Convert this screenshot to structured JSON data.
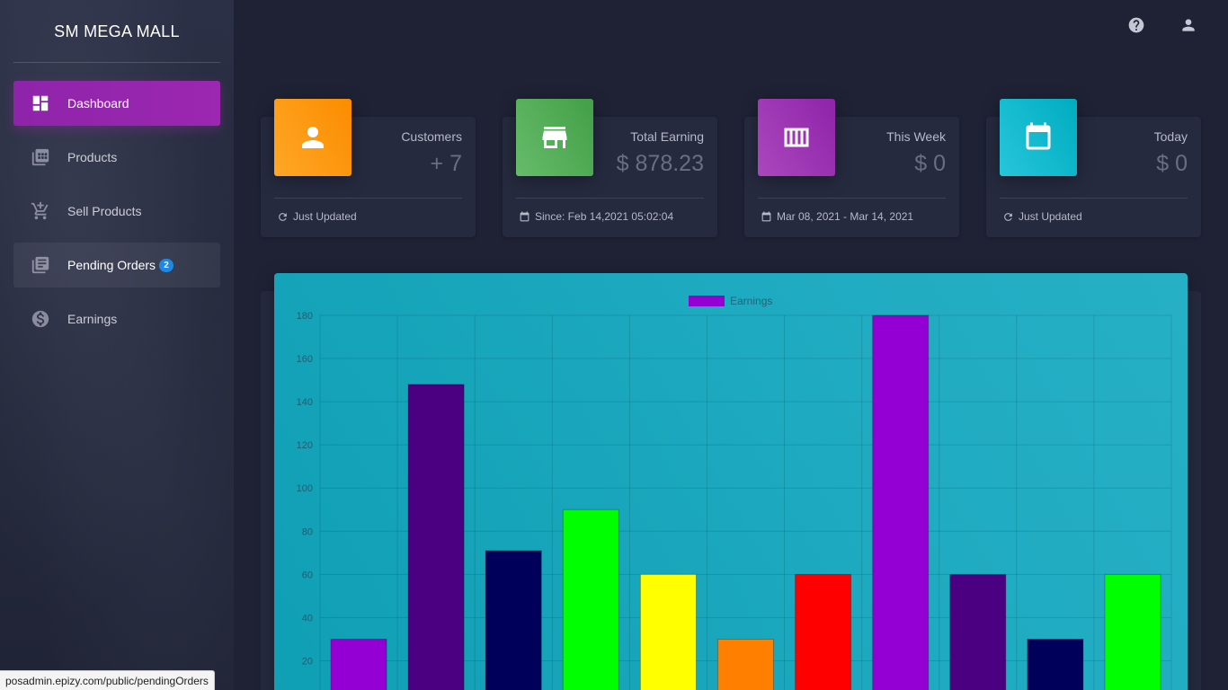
{
  "brand": "SM MEGA MALL",
  "sidebar": {
    "items": [
      {
        "label": "Dashboard",
        "icon": "dashboard-icon",
        "active": true
      },
      {
        "label": "Products",
        "icon": "products-icon"
      },
      {
        "label": "Sell Products",
        "icon": "cart-add-icon"
      },
      {
        "label": "Pending Orders",
        "icon": "orders-icon",
        "badge": "2"
      },
      {
        "label": "Earnings",
        "icon": "dollar-icon"
      }
    ]
  },
  "topbar": {
    "help_icon": "help-icon",
    "user_icon": "user-icon"
  },
  "cards": [
    {
      "title": "Customers",
      "value": "+ 7",
      "footer": "Just Updated",
      "icon": "person-icon",
      "footer_icon": "refresh-icon",
      "color": "#fb8c00"
    },
    {
      "title": "Total Earning",
      "value": "$ 878.23",
      "footer": "Since: Feb 14,2021 05:02:04",
      "icon": "store-icon",
      "footer_icon": "calendar-icon",
      "color": "#43a047"
    },
    {
      "title": "This Week",
      "value": "$ 0",
      "footer": "Mar 08, 2021 - Mar 14, 2021",
      "icon": "week-icon",
      "footer_icon": "calendar-icon",
      "color": "#8e24aa"
    },
    {
      "title": "Today",
      "value": "$ 0",
      "footer": "Just Updated",
      "icon": "calendar-icon",
      "footer_icon": "refresh-icon",
      "color": "#00acc1"
    }
  ],
  "chart_data": {
    "type": "bar",
    "series": [
      {
        "name": "Earnings",
        "values": [
          30,
          148,
          71,
          90,
          60,
          30,
          60,
          180,
          60,
          30,
          60
        ]
      }
    ],
    "colors": [
      "#9400d3",
      "#4b0082",
      "#00005a",
      "#00ff00",
      "#ffff00",
      "#ff7f00",
      "#ff0000",
      "#9400d3",
      "#4b0082",
      "#00005a",
      "#00ff00"
    ],
    "legend_color": "#9400d3",
    "yticks": [
      "20",
      "40",
      "60",
      "80",
      "100",
      "120",
      "140",
      "160",
      "180"
    ],
    "ylim": [
      0,
      180
    ],
    "grid": true,
    "legend": "top-center"
  },
  "status_bar": "posadmin.epizy.com/public/pendingOrders"
}
